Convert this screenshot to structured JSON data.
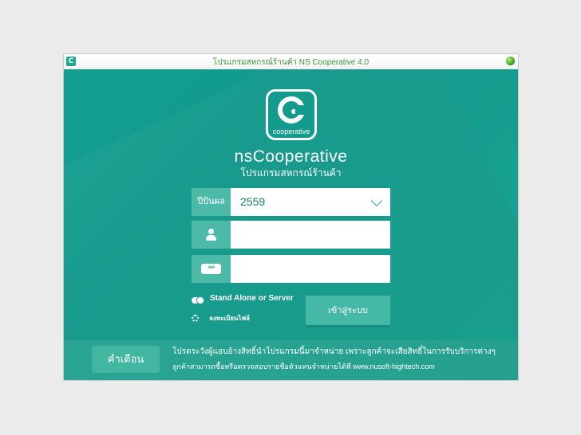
{
  "window": {
    "title": "โปรแกรมสหกรณ์ร้านค้า NS Cooperative 4.0",
    "app_icon_letter": "C"
  },
  "logo": {
    "text": "cooperative"
  },
  "header": {
    "app_name": "nsCooperative",
    "subtitle": "โปรแกรมสหกรณ์ร้านค้า"
  },
  "form": {
    "year_label": "ปีปันผล",
    "year_value": "2559",
    "username_value": "",
    "password_value": "",
    "password_icon_text": "***"
  },
  "options": {
    "mode_label": "Stand Alone or Server",
    "register_label": "ลงทะเบียนไฟล์"
  },
  "login_button": "เข้าสู่ระบบ",
  "footer": {
    "warning_button": "คำเตือน",
    "line1": "โปรดระวังผู้แอบอ้างสิทธิ์นำโปรแกรมนี้มาจำหน่าย เพราะลูกค้าจะเสียสิทธิ์ในการรับบริการต่างๆ",
    "line2": "ลูกค้าสามารถซื้อหรือตรวจสอบรายชื่อตัวแทนจำหน่ายได้ที่ www.nusoft-hightech.com"
  },
  "colors": {
    "primary": "#139f90",
    "accent": "#45b9a6",
    "status_light": "#3aa21b",
    "title_text": "#3c9a3c"
  }
}
